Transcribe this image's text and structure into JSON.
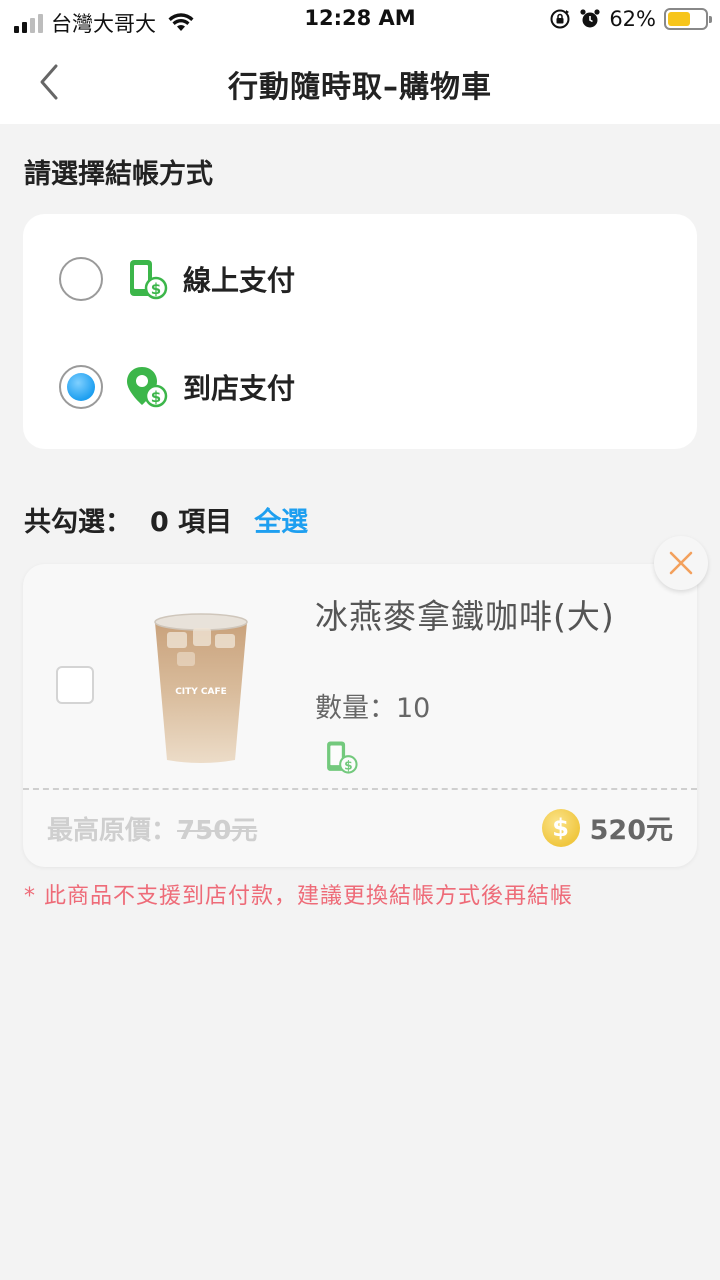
{
  "status_bar": {
    "carrier": "台灣大哥大",
    "time": "12:28 AM",
    "battery_pct": "62%",
    "battery_level": 0.62
  },
  "header": {
    "title": "行動隨時取–購物車",
    "back_icon": "chevron-left-icon"
  },
  "checkout": {
    "section_title": "請選擇結帳方式",
    "options": [
      {
        "label": "線上支付",
        "icon": "phone-dollar-icon",
        "selected": false
      },
      {
        "label": "到店支付",
        "icon": "location-dollar-icon",
        "selected": true
      }
    ]
  },
  "summary": {
    "label": "共勾選：",
    "count": "0 項目",
    "select_all": "全選"
  },
  "item": {
    "name": "冰燕麥拿鐵咖啡(大)",
    "quantity": "數量：10",
    "orig_price_label": "最高原價：",
    "orig_price": "750元",
    "price": "520元",
    "coin_symbol": "$",
    "cup_brand": "CITY CAFE"
  },
  "warning": "* 此商品不支援到店付款，建議更換結帳方式後再結帳",
  "colors": {
    "accent": "#1e9ff0",
    "warning": "#ee6b78",
    "icon_green": "#3cb64a",
    "remove_orange": "#f3a05c"
  }
}
